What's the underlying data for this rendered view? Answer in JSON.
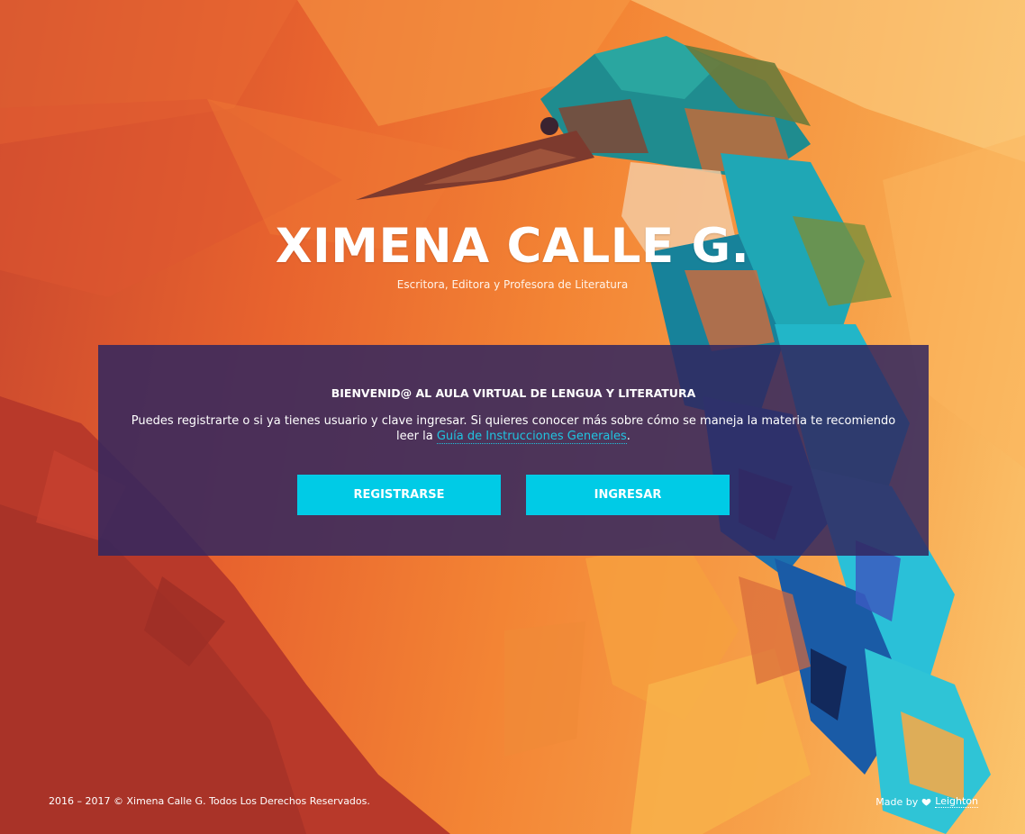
{
  "colors": {
    "panel_bg": "#31275f",
    "accent": "#00cbe6",
    "link": "#20c4e0"
  },
  "hero": {
    "title": "XIMENA CALLE G.",
    "subtitle": "Escritora, Editora y Profesora de Literatura"
  },
  "welcome": {
    "heading": "BIENVENID@ AL AULA VIRTUAL DE LENGUA Y LITERATURA",
    "body_text": "Puedes registrarte o si ya tienes usuario y clave ingresar. Si quieres conocer más sobre cómo se maneja la materia te recomiendo leer la ",
    "link_text": "Guía de Instrucciones Generales",
    "after_link": "."
  },
  "buttons": {
    "register": "REGISTRARSE",
    "login": "INGRESAR"
  },
  "footer": {
    "copyright": "2016 – 2017 © Ximena Calle G. Todos Los Derechos Reservados.",
    "made_by": "Made by",
    "heart_icon": "heart-icon",
    "author": "Leighton"
  }
}
